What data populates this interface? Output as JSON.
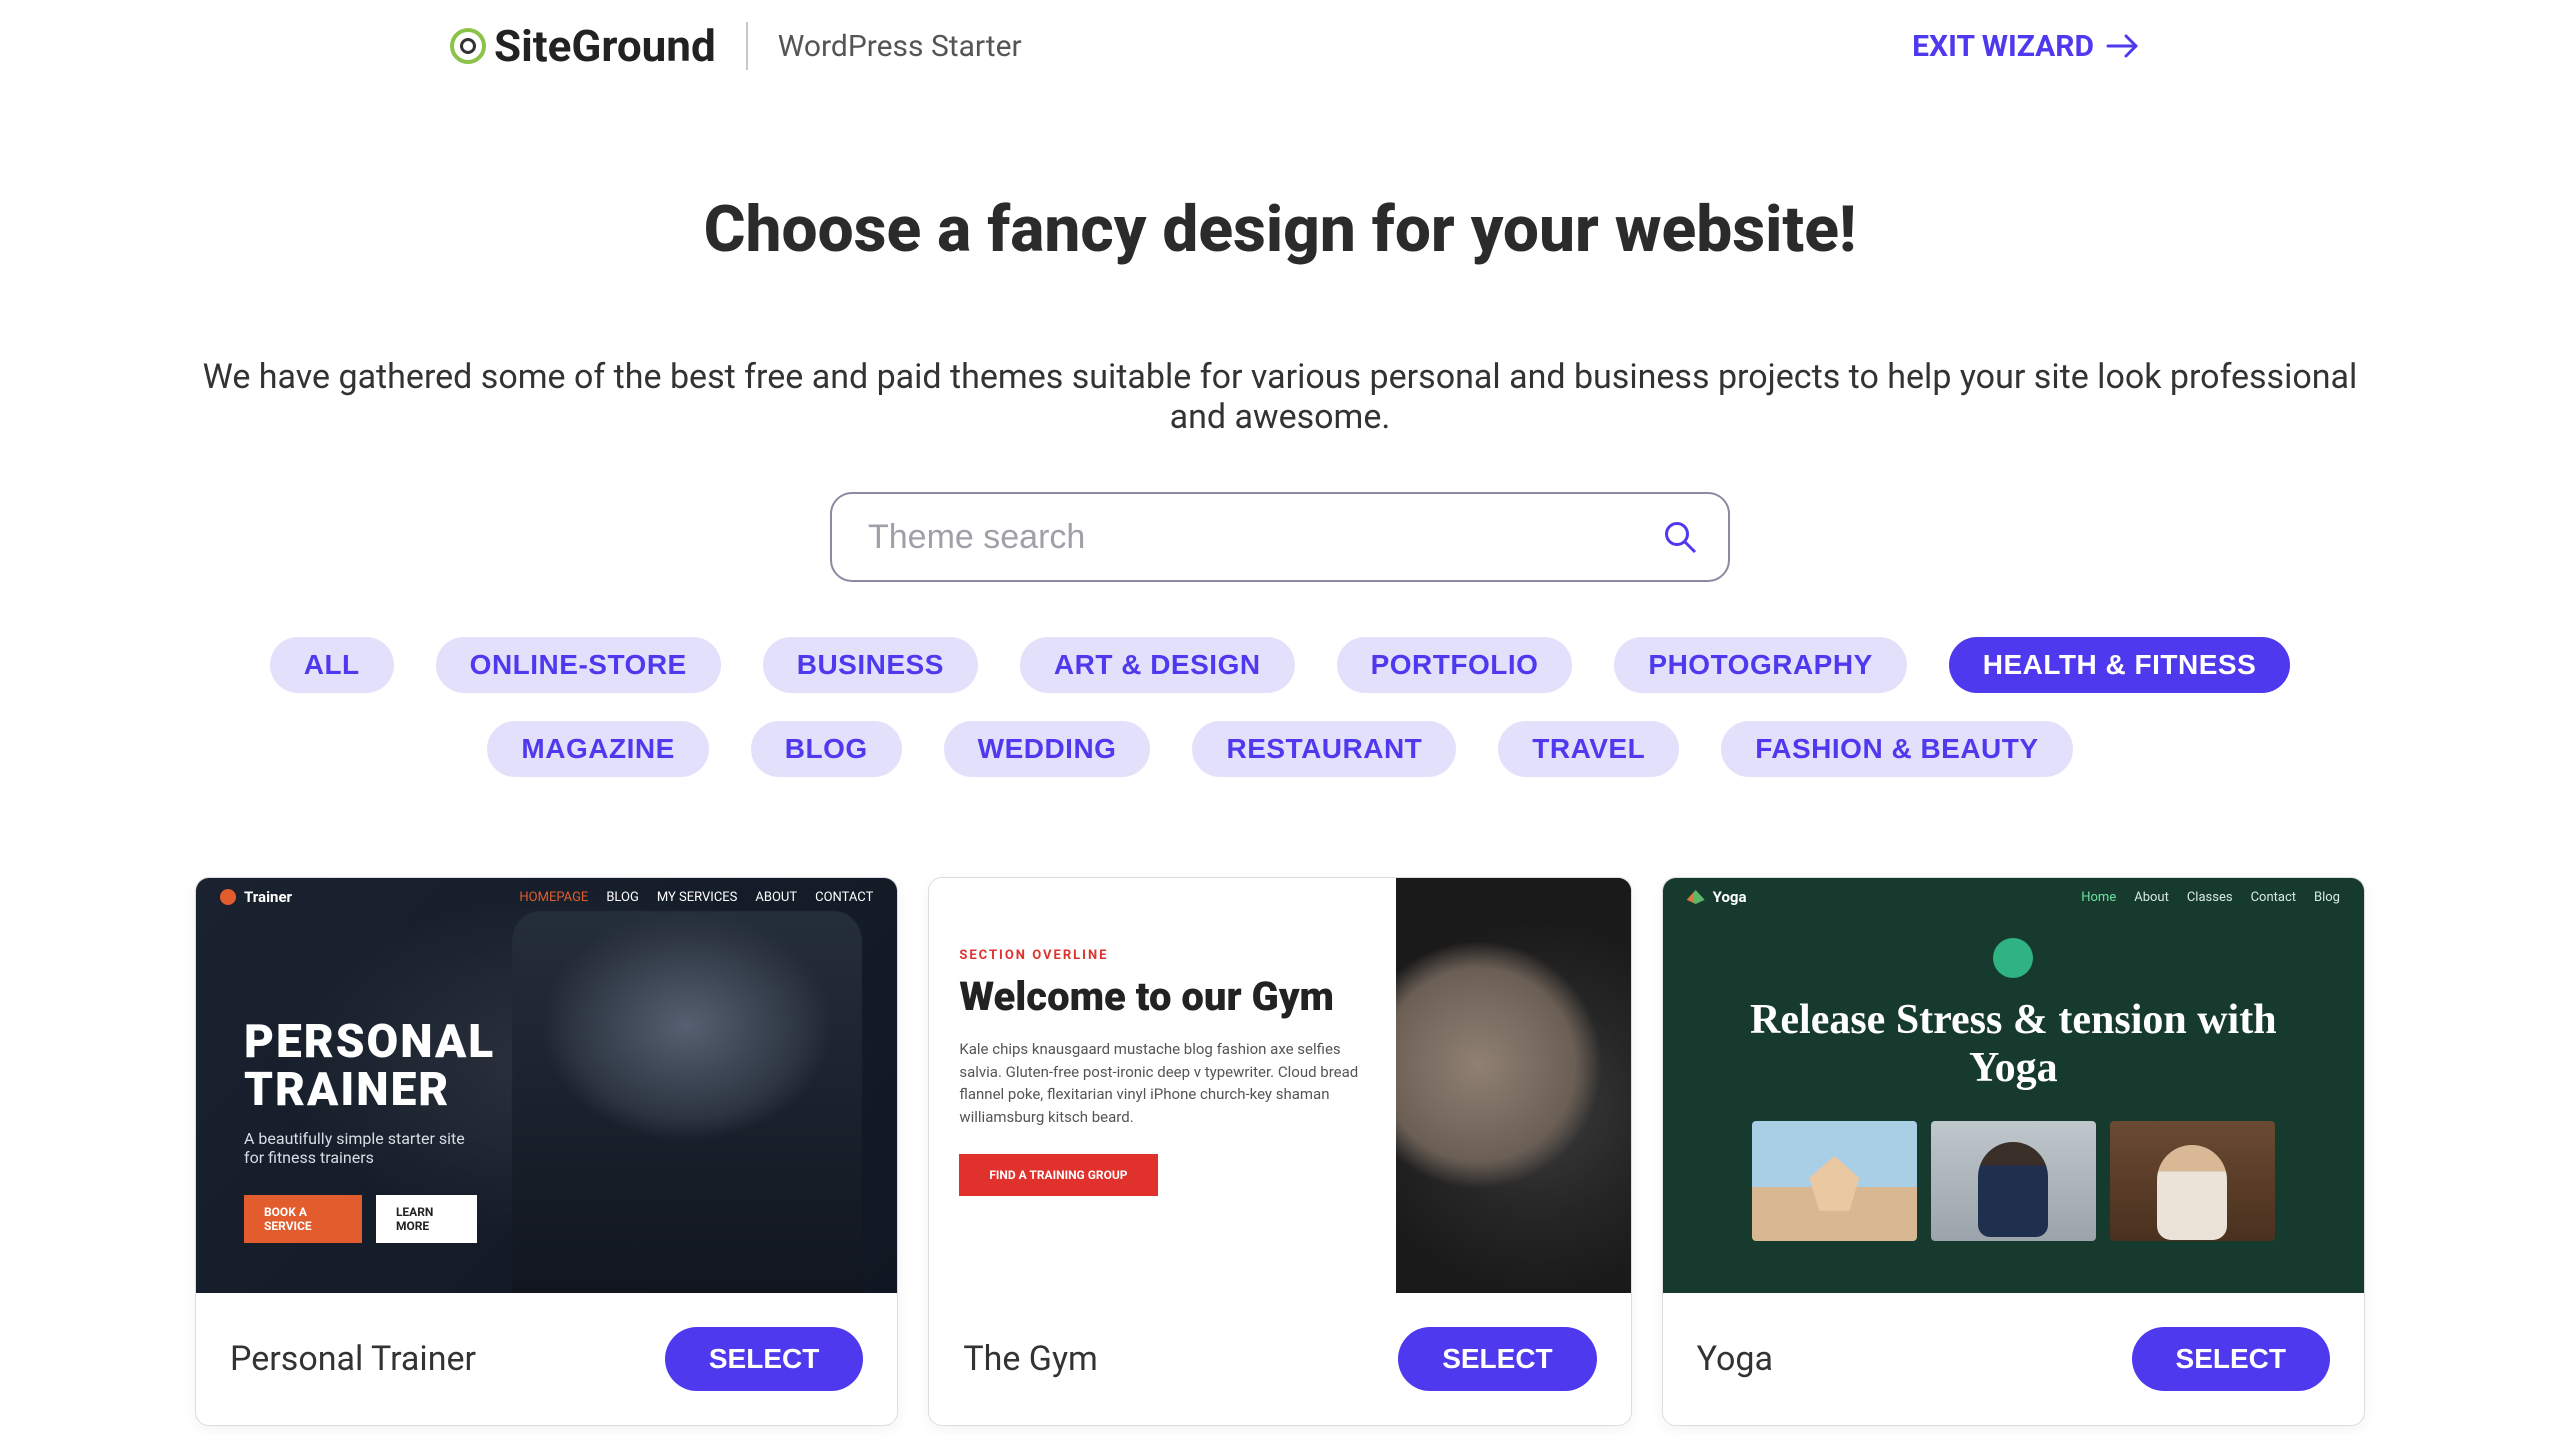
{
  "header": {
    "logo_text": "SiteGround",
    "app_name": "WordPress Starter",
    "exit_label": "EXIT WIZARD"
  },
  "page": {
    "title": "Choose a fancy design for your website!",
    "subtitle": "We have gathered some of the best free and paid themes suitable for various personal and business projects to help your site look professional and awesome."
  },
  "search": {
    "placeholder": "Theme search",
    "value": ""
  },
  "categories": [
    {
      "label": "ALL",
      "active": false
    },
    {
      "label": "ONLINE-STORE",
      "active": false
    },
    {
      "label": "BUSINESS",
      "active": false
    },
    {
      "label": "ART & DESIGN",
      "active": false
    },
    {
      "label": "PORTFOLIO",
      "active": false
    },
    {
      "label": "PHOTOGRAPHY",
      "active": false
    },
    {
      "label": "HEALTH & FITNESS",
      "active": true
    },
    {
      "label": "MAGAZINE",
      "active": false
    },
    {
      "label": "BLOG",
      "active": false
    },
    {
      "label": "WEDDING",
      "active": false
    },
    {
      "label": "RESTAURANT",
      "active": false
    },
    {
      "label": "TRAVEL",
      "active": false
    },
    {
      "label": "FASHION & BEAUTY",
      "active": false
    }
  ],
  "themes": [
    {
      "name": "Personal Trainer",
      "select_label": "SELECT",
      "preview": {
        "brand": "Trainer",
        "nav": [
          "HOMEPAGE",
          "BLOG",
          "MY SERVICES",
          "ABOUT",
          "CONTACT"
        ],
        "hero_title_line1": "PERSONAL",
        "hero_title_line2": "TRAINER",
        "hero_sub": "A beautifully simple starter site for fitness trainers",
        "btn1": "BOOK A SERVICE",
        "btn2": "LEARN MORE"
      }
    },
    {
      "name": "The Gym",
      "select_label": "SELECT",
      "preview": {
        "overline": "SECTION OVERLINE",
        "hero_title": "Welcome to our Gym",
        "body": "Kale chips knausgaard mustache blog fashion axe selfies salvia. Gluten-free post-ironic deep v typewriter. Cloud bread flannel poke, flexitarian vinyl iPhone church-key shaman williamsburg kitsch beard.",
        "cta": "FIND A TRAINING GROUP"
      }
    },
    {
      "name": "Yoga",
      "select_label": "SELECT",
      "preview": {
        "brand": "Yoga",
        "nav": [
          "Home",
          "About",
          "Classes",
          "Contact",
          "Blog"
        ],
        "hero_title": "Release Stress & tension with Yoga"
      }
    }
  ]
}
